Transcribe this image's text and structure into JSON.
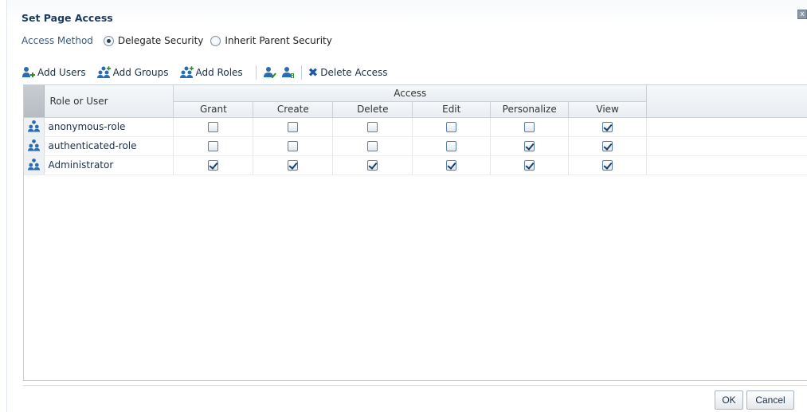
{
  "dialog": {
    "title": "Set Page Access",
    "close_glyph": "x"
  },
  "access_method": {
    "label": "Access Method",
    "options": [
      {
        "label": "Delegate Security",
        "selected": true
      },
      {
        "label": "Inherit Parent Security",
        "selected": false
      }
    ]
  },
  "toolbar": {
    "add_users": "Add Users",
    "add_groups": "Add Groups",
    "add_roles": "Add Roles",
    "delete_access": "Delete Access",
    "icons": [
      "add-users-icon",
      "add-groups-icon",
      "add-roles-icon",
      "people-check-icon",
      "people-info-icon",
      "delete-x-icon"
    ]
  },
  "table": {
    "role_header": "Role or User",
    "group_header": "Access",
    "columns": [
      "Grant",
      "Create",
      "Delete",
      "Edit",
      "Personalize",
      "View"
    ],
    "rows": [
      {
        "name": "anonymous-role",
        "icon": "role-icon",
        "values": [
          false,
          false,
          false,
          false,
          false,
          true
        ]
      },
      {
        "name": "authenticated-role",
        "icon": "role-icon",
        "values": [
          false,
          false,
          false,
          false,
          true,
          true
        ]
      },
      {
        "name": "Administrator",
        "icon": "role-icon",
        "values": [
          true,
          true,
          true,
          true,
          true,
          true
        ]
      }
    ]
  },
  "buttons": {
    "ok": "OK",
    "cancel": "Cancel"
  },
  "colors": {
    "title": "#1d3a5c",
    "icon_blue": "#2a6cb3",
    "check": "#1c3e63"
  }
}
